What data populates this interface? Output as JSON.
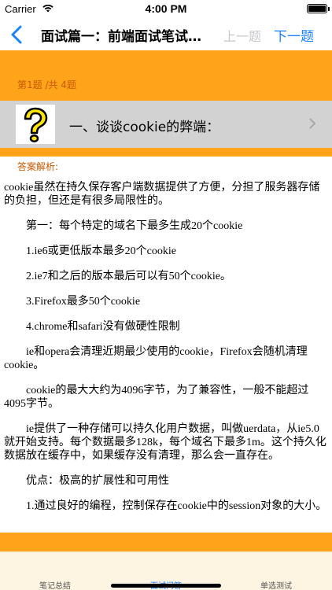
{
  "status_bar": {
    "carrier": "Carrier",
    "time": "4:00 PM"
  },
  "nav": {
    "title": "面试篇一：前端面试笔试题（一）",
    "prev_label": "上一题",
    "next_label": "下一题"
  },
  "question": {
    "counter": "第1题 /共 4题",
    "icon": "question-mark-icon",
    "title": "一、谈谈cookie的弊端：",
    "answer_label": "答案解析:"
  },
  "answer_paragraphs": [
    "cookie虽然在持久保存客户端数据提供了方便，分担了服务器存储的负担，但还是有很多局限性的。",
    "第一：每个特定的域名下最多生成20个cookie",
    "1.ie6或更低版本最多20个cookie",
    "2.ie7和之后的版本最后可以有50个cookie。",
    "3.Firefox最多50个cookie",
    "4.chrome和safari没有做硬性限制",
    "ie和opera会清理近期最少使用的cookie，Firefox会随机清理cookie。",
    "cookie的最大大约为4096字节，为了兼容性，一般不能超过4095字节。",
    "ie提供了一种存储可以持久化用户数据，叫做uerdata，从ie5.0就开始支持。每个数据最多128k，每个域名下最多1m。这个持久化数据放在缓存中，如果缓存没有清理，那么会一直存在。",
    "优点：极高的扩展性和可用性",
    "1.通过良好的编程，控制保存在cookie中的session对象的大小。"
  ],
  "tabs": [
    {
      "label": "笔记总结"
    },
    {
      "label": "面试问答"
    },
    {
      "label": "单选测试"
    }
  ],
  "colors": {
    "accent": "#ffa31a",
    "link": "#1a82ff",
    "row": "#d2d2d2"
  }
}
